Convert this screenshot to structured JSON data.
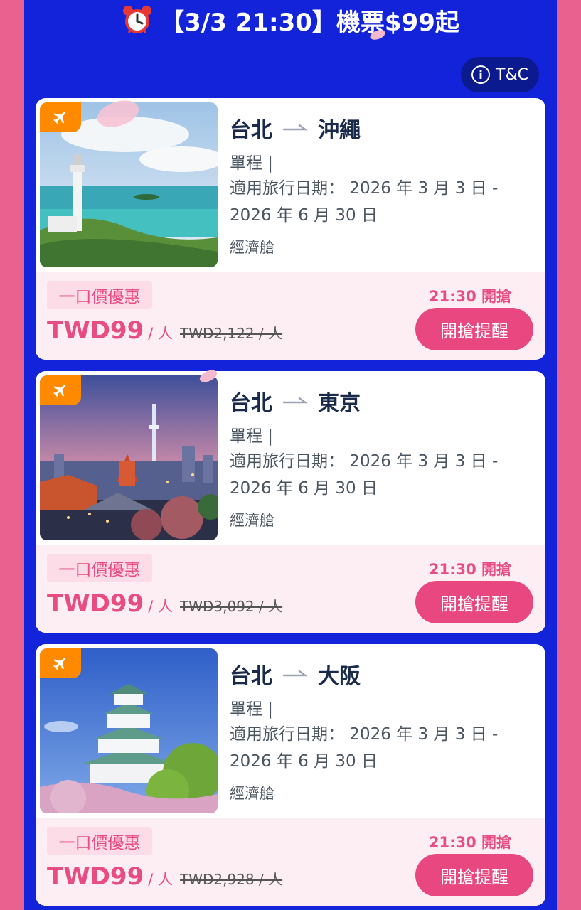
{
  "header": {
    "title": "【3/3 21:30】機票$99起",
    "icon": "alarm-clock-icon"
  },
  "tc_button": {
    "label": "T&C",
    "icon": "info-icon"
  },
  "colors": {
    "panel": "#1323d9",
    "page": "#e9618f",
    "accent": "#e94c82",
    "badge": "#ff8a00"
  },
  "flights": [
    {
      "origin": "台北",
      "destination": "沖繩",
      "trip": "單程 |",
      "dates": "適用旅行日期： 2026 年 3 月 3 日 - 2026 年 6 月 30 日",
      "cabin": "經濟艙",
      "tag": "一口價優惠",
      "price": "TWD99",
      "per": "/ 人",
      "original": "TWD2,122 / 人",
      "time": "21:30 開搶",
      "button": "開搶提醒"
    },
    {
      "origin": "台北",
      "destination": "東京",
      "trip": "單程 |",
      "dates": "適用旅行日期： 2026 年 3 月 3 日 - 2026 年 6 月 30 日",
      "cabin": "經濟艙",
      "tag": "一口價優惠",
      "price": "TWD99",
      "per": "/ 人",
      "original": "TWD3,092 / 人",
      "time": "21:30 開搶",
      "button": "開搶提醒"
    },
    {
      "origin": "台北",
      "destination": "大阪",
      "trip": "單程 |",
      "dates": "適用旅行日期： 2026 年 3 月 3 日 - 2026 年 6 月 30 日",
      "cabin": "經濟艙",
      "tag": "一口價優惠",
      "price": "TWD99",
      "per": "/ 人",
      "original": "TWD2,928 / 人",
      "time": "21:30 開搶",
      "button": "開搶提醒"
    }
  ]
}
